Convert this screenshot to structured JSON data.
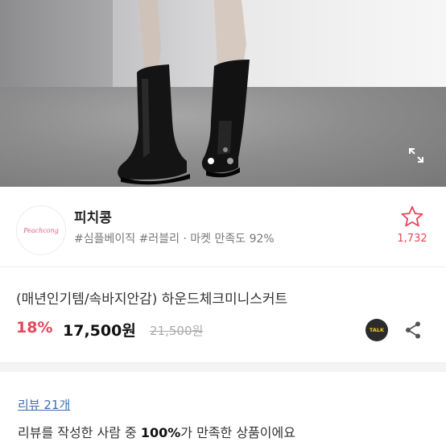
{
  "hero": {
    "image_subject": "model wearing black knee-high boots",
    "carousel_dots": [
      {
        "active": true
      },
      {
        "active": false
      }
    ],
    "expand_icon": "expand-icon"
  },
  "seller": {
    "logo_text": "Peachcong",
    "name": "피치콩",
    "tags": "#심플베이직 #러블리 · 마켓 만족도 92%",
    "favorite_icon": "star-outline-icon",
    "favorite_count": "1,732",
    "accent_color": "#e8455a"
  },
  "product": {
    "title": "(매년인기템/속바지안감)  하운드체크미니스커트",
    "discount": "18%",
    "price": "17,500원",
    "original_price": "21,500원",
    "talk_label": "TALK",
    "share_icon": "share-icon"
  },
  "reviews": {
    "link_label": "리뷰 21개",
    "summary_prefix": "리뷰를 작성한 사람 중 ",
    "summary_percent": "100%",
    "summary_suffix": "가 만족한 상품이에요"
  }
}
